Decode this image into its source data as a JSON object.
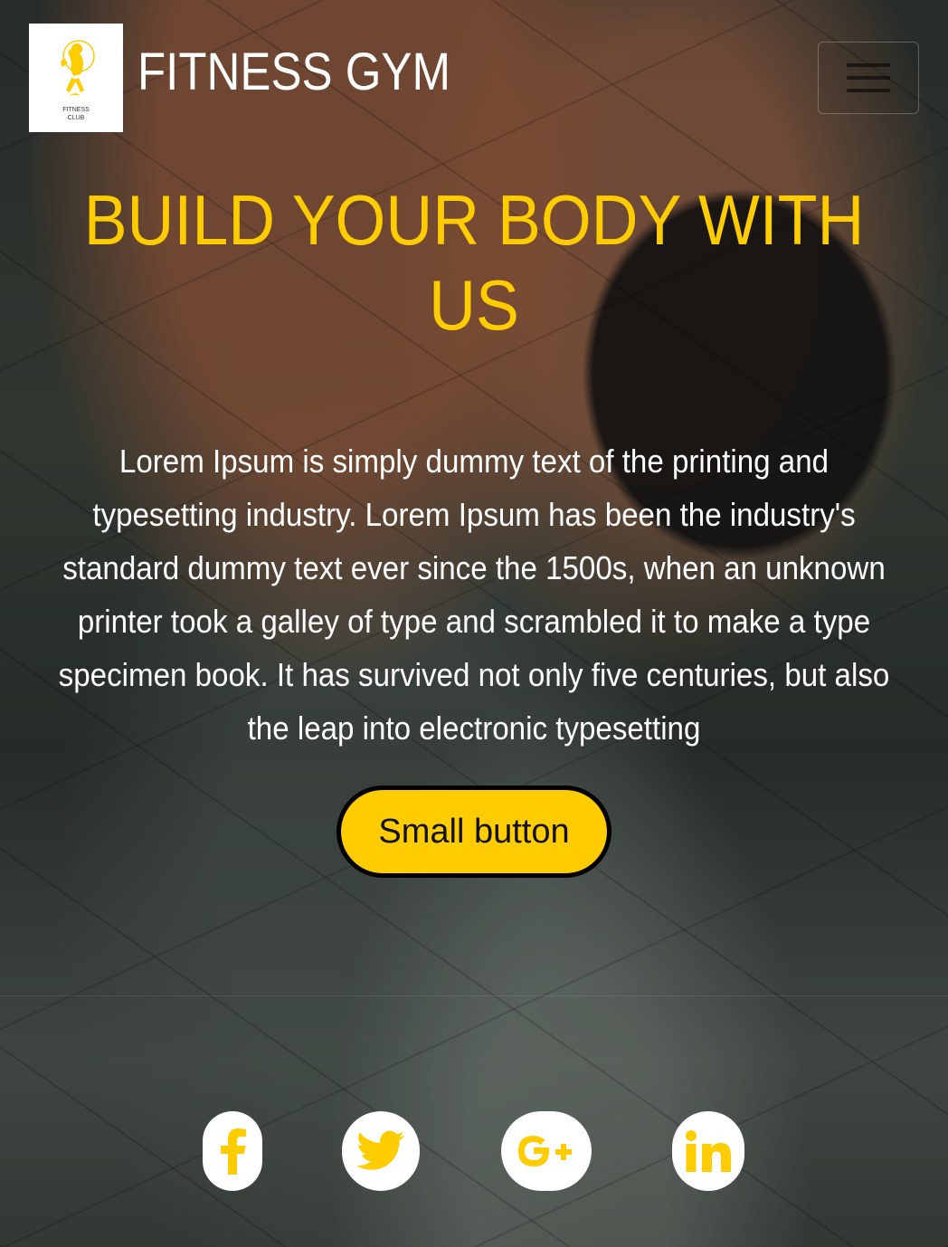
{
  "header": {
    "brand": "FITNESS GYM",
    "logo_text_line1": "FITNESS",
    "logo_text_line2": "CLUB",
    "menu_icon": "hamburger-menu-icon"
  },
  "hero": {
    "title": "BUILD YOUR BODY WITH US",
    "body": "Lorem Ipsum is simply dummy text of the printing and typesetting industry. Lorem Ipsum has been the industry's standard dummy text ever since the 1500s, when an unknown printer took a galley of type and scrambled it to make a type specimen book. It has survived not only five centuries, but also the leap into electronic typesetting",
    "button_label": "Small button"
  },
  "social": [
    {
      "name": "facebook-icon",
      "glyph": "f"
    },
    {
      "name": "twitter-icon",
      "glyph": "🐦"
    },
    {
      "name": "google-plus-icon",
      "glyph": "G+"
    },
    {
      "name": "linkedin-icon",
      "glyph": "in"
    }
  ],
  "colors": {
    "accent": "#ffcc00",
    "text": "#ffffff",
    "button_border": "#000000"
  }
}
